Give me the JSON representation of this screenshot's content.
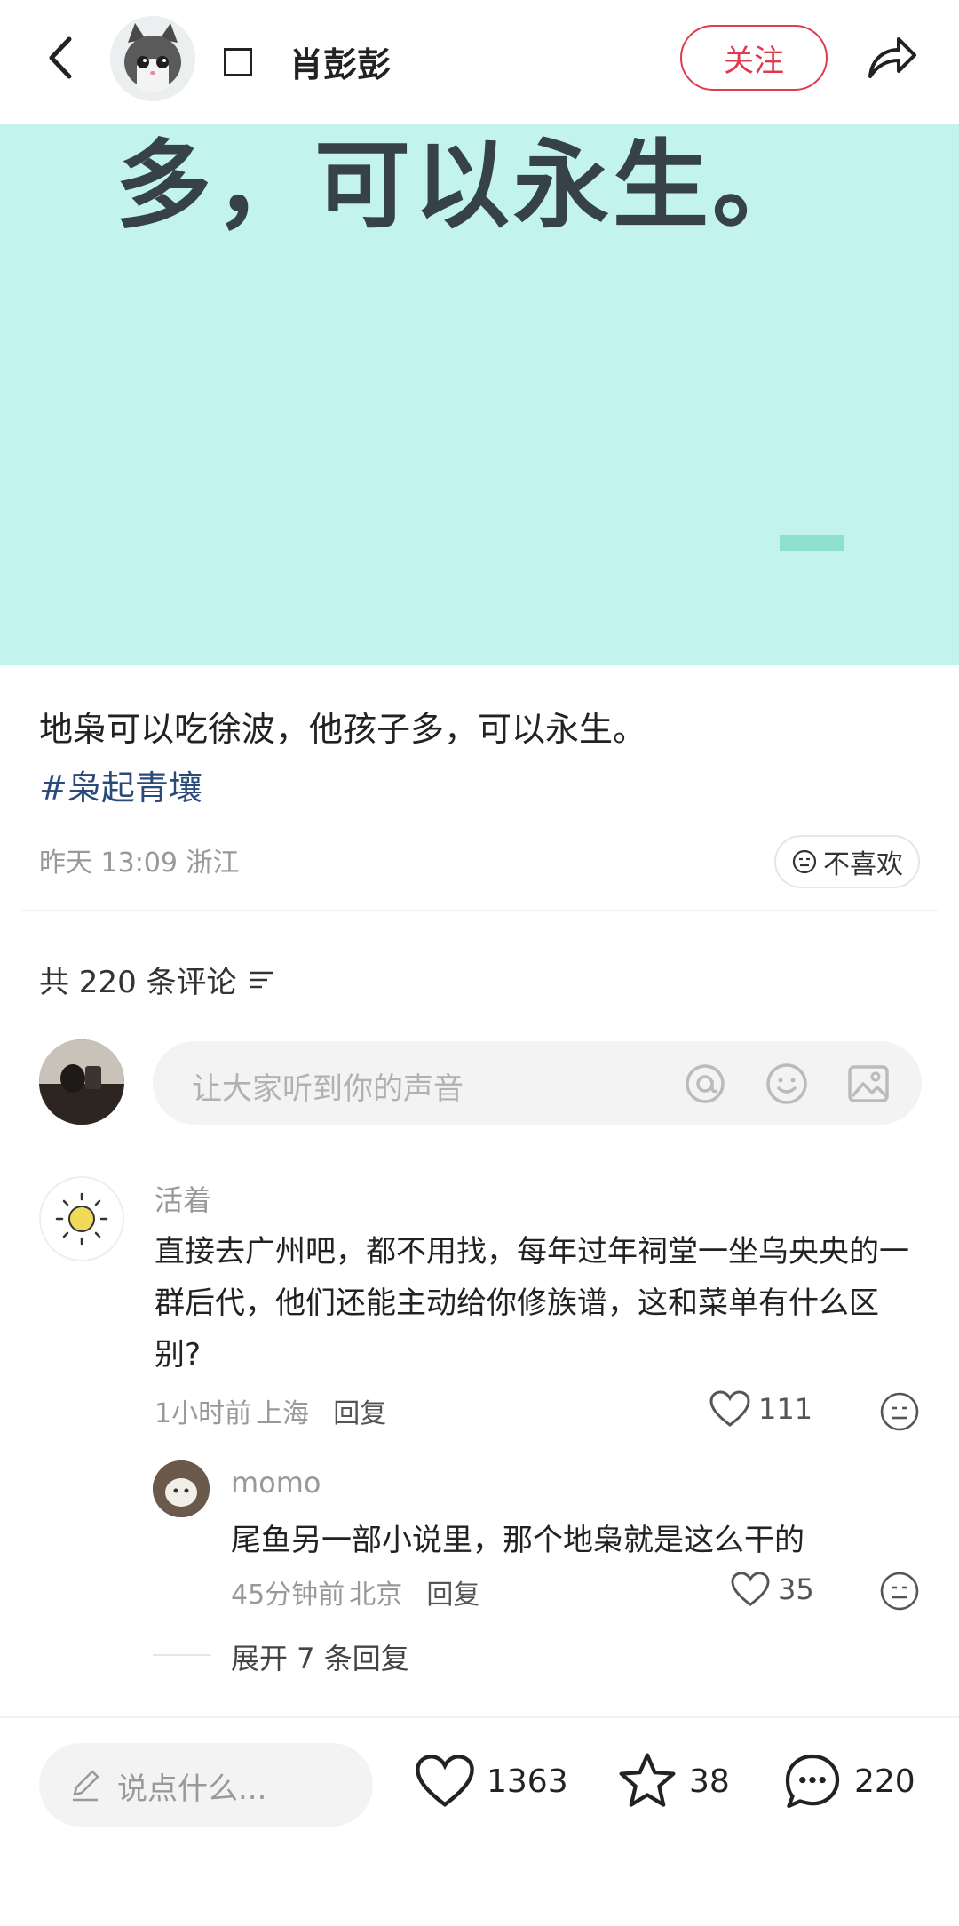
{
  "header": {
    "username": "肖彭彭",
    "follow_label": "关注"
  },
  "banner": {
    "text": "多，可以永生。",
    "colors": {
      "background": "#c2f3ec",
      "text": "#364247"
    }
  },
  "post": {
    "text": "地枭可以吃徐波，他孩子多，可以永生。",
    "hashtag": "#枭起青壤",
    "time": "昨天 13:09",
    "location": "浙江",
    "dislike_label": "不喜欢"
  },
  "comments_header": {
    "count_label": "共 220 条评论"
  },
  "comment_input": {
    "placeholder": "让大家听到你的声音"
  },
  "comments": [
    {
      "author": "活着",
      "text": "直接去广州吧，都不用找，每年过年祠堂一坐乌央央的一群后代，他们还能主动给你修族谱，这和菜单有什么区别?",
      "time": "1小时前",
      "location": "上海",
      "reply_label": "回复",
      "likes": "111"
    },
    {
      "author": "momo",
      "text": "尾鱼另一部小说里，那个地枭就是这么干的",
      "time": "45分钟前",
      "location": "北京",
      "reply_label": "回复",
      "likes": "35"
    }
  ],
  "expand_replies": "展开 7 条回复",
  "bottom_bar": {
    "say_placeholder": "说点什么...",
    "likes": "1363",
    "stars": "38",
    "comments": "220"
  },
  "accent_color": "#e23a4d"
}
